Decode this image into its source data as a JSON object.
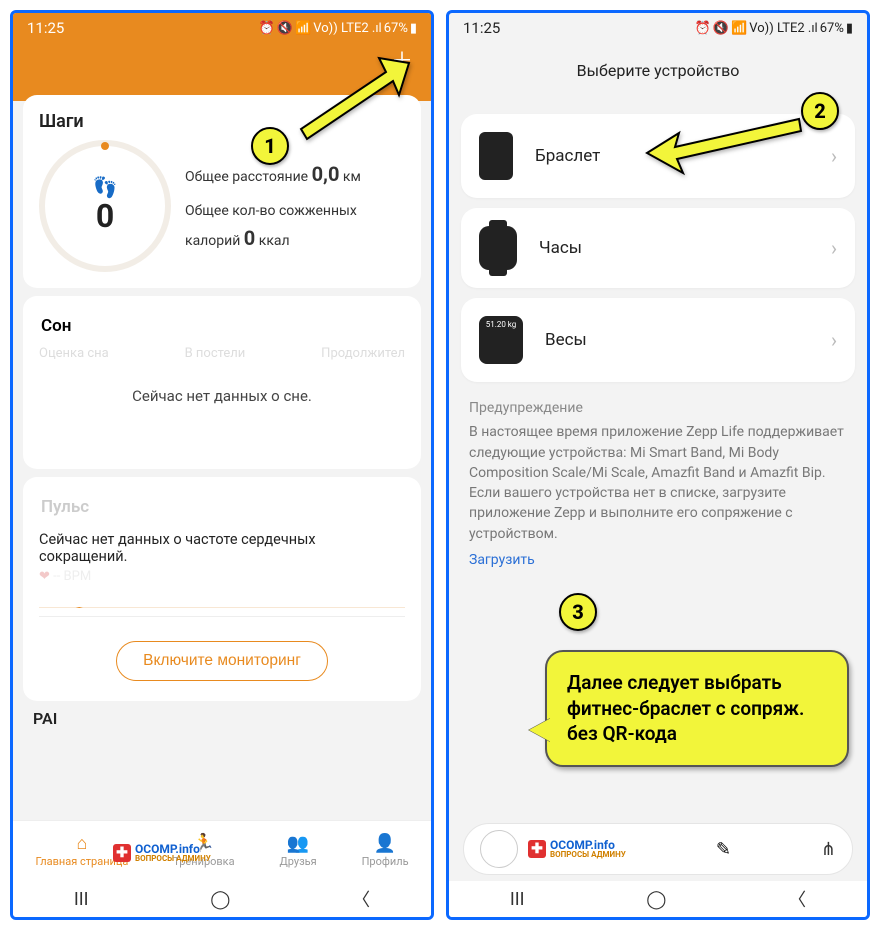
{
  "status": {
    "time": "11:25",
    "battery": "67%",
    "network": "Vo)) LTE2 .ıl"
  },
  "left": {
    "steps": {
      "title": "Шаги",
      "count": "0",
      "distance_label": "Общее расстояние",
      "distance_value": "0,0",
      "distance_unit": "км",
      "calories_label": "Общее кол-во сожженных калорий",
      "calories_value": "0",
      "calories_unit": "ккал"
    },
    "sleep": {
      "title": "Сон",
      "col1": "Оценка сна",
      "col2": "В постели",
      "col3": "Продолжител",
      "empty": "Сейчас нет данных о сне."
    },
    "pulse": {
      "title": "Пульс",
      "empty": "Сейчас нет данных о частоте сердечных сокращений.",
      "bpm": "-- BPM",
      "button": "Включите мониторинг"
    },
    "pai": "PAI",
    "nav": {
      "home": "Главная страница",
      "workout": "Тренировка",
      "friends": "Друзья",
      "profile": "Профиль"
    }
  },
  "right": {
    "title": "Выберите устройство",
    "devices": {
      "band": "Браслет",
      "watch": "Часы",
      "scale": "Весы",
      "scale_badge": "51.20 kg"
    },
    "warning": {
      "title": "Предупреждение",
      "body": "В настоящее время приложение Zepp Life поддерживает следующие устройства: Mi Smart Band, Mi Body Composition Scale/Mi Scale, Amazfit Band и Amazfit Bip. Если вашего устройства нет в списке, загрузите приложение Zepp и выполните его сопряжение с устройством.",
      "download": "Загрузить"
    }
  },
  "annotations": {
    "n1": "1",
    "n2": "2",
    "n3": "3",
    "callout": "Далее следует выбрать фитнес-браслет с сопряж. без QR-кода"
  },
  "watermark": {
    "main": "OCOMP.info",
    "sub": "ВОПРОСЫ АДМИНУ"
  }
}
